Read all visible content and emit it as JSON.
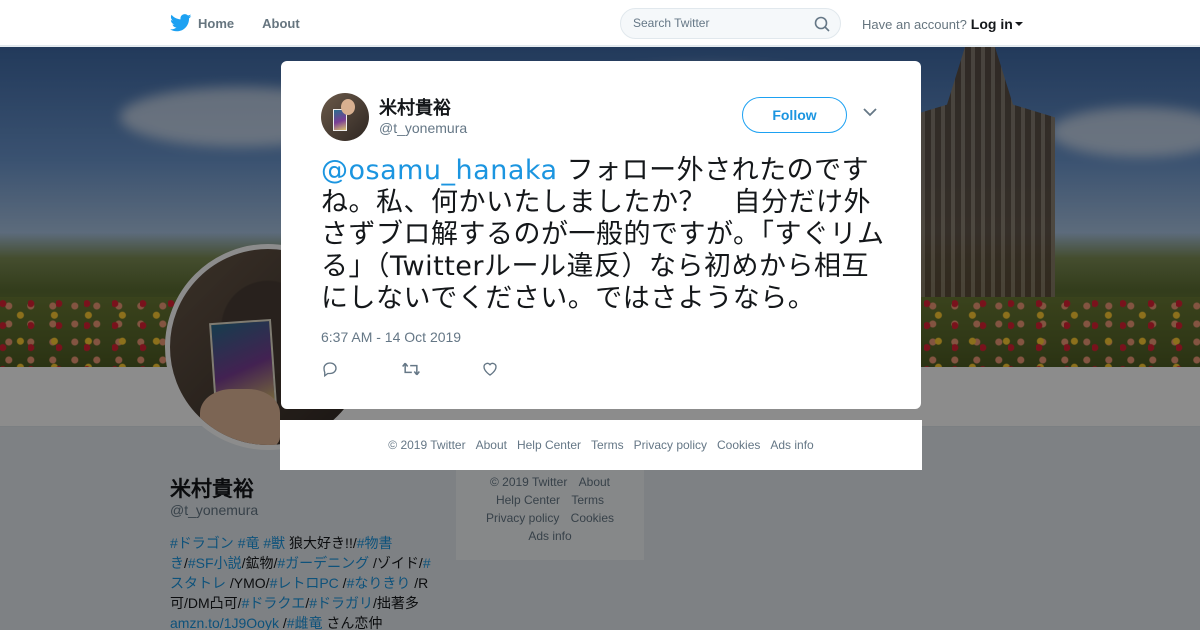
{
  "nav": {
    "home_label": "Home",
    "about_label": "About",
    "search_placeholder": "Search Twitter",
    "have_account": "Have an account?",
    "login_label": "Log in",
    "brand_color": "#1da1f2"
  },
  "profile": {
    "name": "米村貴裕",
    "handle": "@t_yonemura",
    "bio": [
      {
        "text": "#ドラゴン",
        "tag": true
      },
      {
        "text": " ",
        "tag": false
      },
      {
        "text": "#竜",
        "tag": true
      },
      {
        "text": " ",
        "tag": false
      },
      {
        "text": "#獣",
        "tag": true
      },
      {
        "text": " 狼大好き!!/",
        "tag": false
      },
      {
        "text": "#物書き",
        "tag": true
      },
      {
        "text": "/",
        "tag": false
      },
      {
        "text": "#SF小説",
        "tag": true
      },
      {
        "text": "/鉱物/",
        "tag": false
      },
      {
        "text": "#ガーデニング",
        "tag": true
      },
      {
        "text": " /ゾイド/",
        "tag": false
      },
      {
        "text": "#スタトレ",
        "tag": true
      },
      {
        "text": " /YMO/",
        "tag": false
      },
      {
        "text": "#レトロPC",
        "tag": true
      },
      {
        "text": " /",
        "tag": false
      },
      {
        "text": "#なりきり",
        "tag": true
      },
      {
        "text": " /R可/DM凸可/",
        "tag": false
      },
      {
        "text": "#ドラクエ",
        "tag": true
      },
      {
        "text": "/",
        "tag": false
      },
      {
        "text": "#ドラガリ",
        "tag": true
      },
      {
        "text": "/拙著多 ",
        "tag": false
      },
      {
        "text": "amzn.to/1J9Ooyk",
        "tag": true
      },
      {
        "text": " /",
        "tag": false
      },
      {
        "text": "#雌竜",
        "tag": true
      },
      {
        "text": " さん恋仲",
        "tag": false
      }
    ]
  },
  "side_footer": {
    "copyright": "© 2019 Twitter",
    "about": "About",
    "help": "Help Center",
    "terms": "Terms",
    "privacy": "Privacy policy",
    "cookies": "Cookies",
    "ads": "Ads info"
  },
  "tweet": {
    "author_name": "米村貴裕",
    "author_handle": "@t_yonemura",
    "follow_label": "Follow",
    "mention": "@osamu_hanaka",
    "body": " フォロー外されたのですね。私、何かいたしましたか？　自分だけ外さずブロ解するのが一般的ですが。「すぐリムる」（Twitterルール違反）なら初めから相互にしないでください。ではさようなら。",
    "timestamp": "6:37 AM - 14 Oct 2019"
  },
  "modal_footer": {
    "copyright": "© 2019 Twitter",
    "about": "About",
    "help": "Help Center",
    "terms": "Terms",
    "privacy": "Privacy policy",
    "cookies": "Cookies",
    "ads": "Ads info"
  }
}
